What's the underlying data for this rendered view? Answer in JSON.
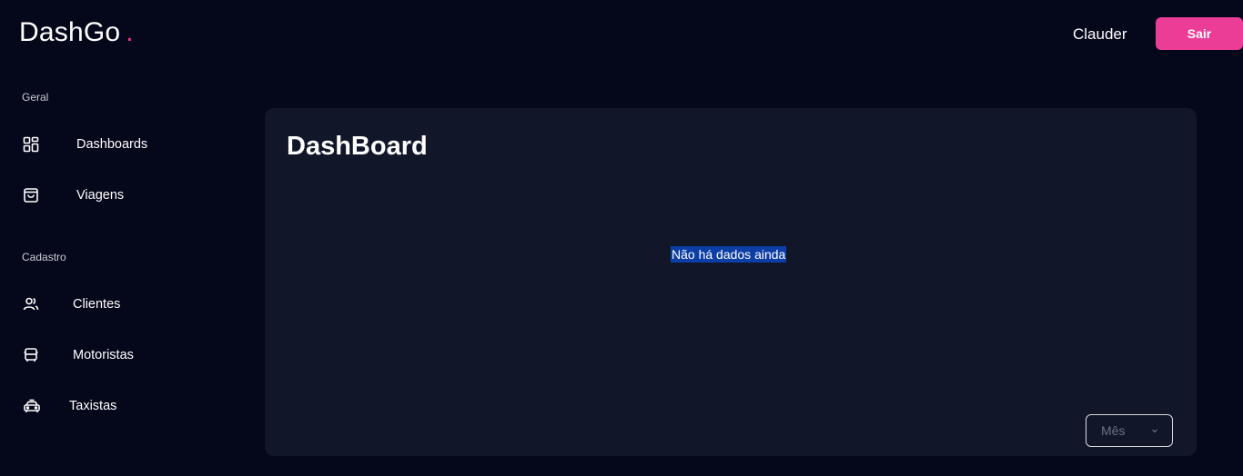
{
  "header": {
    "logo_text": "DashGo",
    "logo_dot": ".",
    "user_name": "Clauder",
    "logout_label": "Sair"
  },
  "sidebar": {
    "sections": [
      {
        "title": "Geral",
        "items": [
          {
            "label": "Dashboards",
            "icon": "dashboard-grid-icon"
          },
          {
            "label": "Viagens",
            "icon": "shopping-bag-icon"
          }
        ]
      },
      {
        "title": "Cadastro",
        "items": [
          {
            "label": "Clientes",
            "icon": "users-icon"
          },
          {
            "label": "Motoristas",
            "icon": "bus-icon"
          },
          {
            "label": "Taxistas",
            "icon": "taxi-icon"
          }
        ]
      }
    ]
  },
  "main": {
    "title": "DashBoard",
    "empty_message": "Não há dados ainda",
    "period_select": {
      "value": "Mês"
    }
  },
  "colors": {
    "background": "#05071a",
    "panel": "#111729",
    "accent": "#ec3d96",
    "selection": "#0c3ea6"
  }
}
